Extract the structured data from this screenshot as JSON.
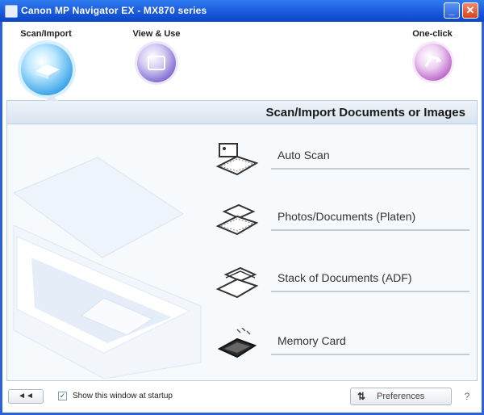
{
  "window": {
    "title": "Canon MP Navigator EX - MX870 series",
    "icons": {
      "minimize": "minimize-icon",
      "close": "close-icon"
    },
    "minimize_glyph": "_",
    "close_glyph": "✕"
  },
  "modes": [
    {
      "label": "Scan/Import",
      "icon": "scanner-icon",
      "selected": true
    },
    {
      "label": "View & Use",
      "icon": "photo-album-icon",
      "selected": false
    },
    {
      "label": "One-click",
      "icon": "one-click-icon",
      "selected": false
    }
  ],
  "panel": {
    "title": "Scan/Import Documents or Images"
  },
  "options": [
    {
      "label": "Auto Scan",
      "icon": "auto-scan-icon"
    },
    {
      "label": "Photos/Documents (Platen)",
      "icon": "platen-icon"
    },
    {
      "label": "Stack of Documents (ADF)",
      "icon": "adf-icon"
    },
    {
      "label": "Memory Card",
      "icon": "memory-card-icon"
    }
  ],
  "bottom": {
    "left_button": "◄◄",
    "show_window_label": "Show this window at startup",
    "show_window_checked": true,
    "check_glyph": "✓",
    "preferences_label": "Preferences",
    "preferences_icon_glyph": "⇅",
    "help_glyph": "?"
  },
  "colors": {
    "titlebar": "#1f5fe0",
    "panel_header": "#d9e4f0",
    "scan_accent": "#3ba3e8",
    "view_accent": "#6b54c8",
    "oneclick_accent": "#b14ec0"
  }
}
